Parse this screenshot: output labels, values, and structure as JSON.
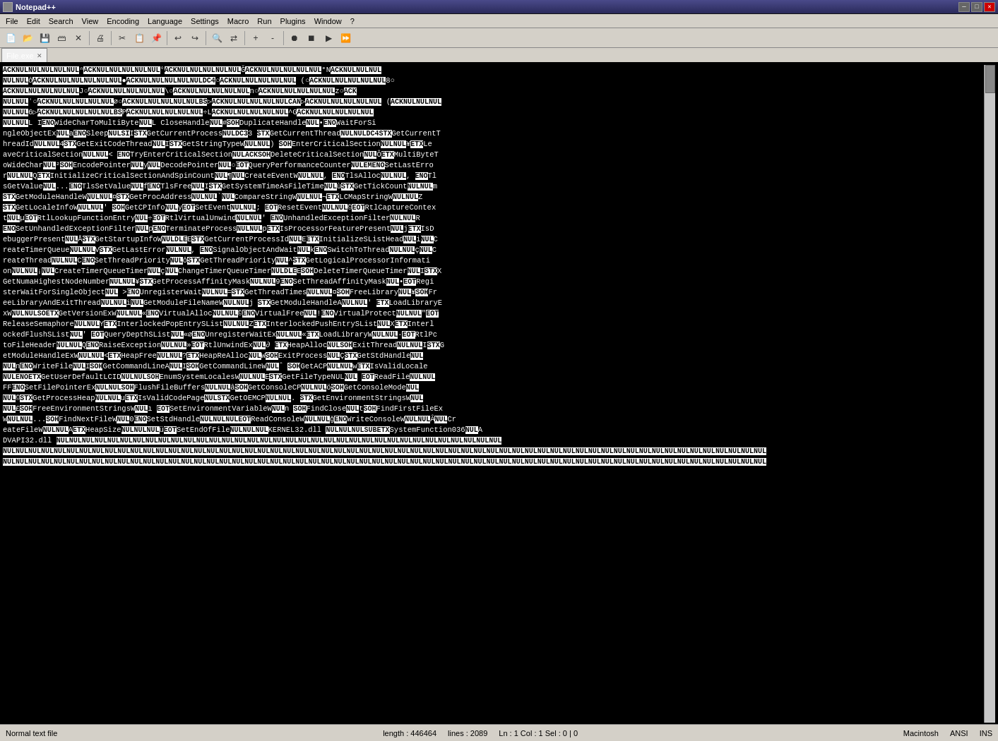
{
  "titleBar": {
    "title": "Notepad++",
    "minimize": "─",
    "maximize": "□",
    "close": "✕"
  },
  "menuBar": {
    "items": [
      "File",
      "Edit",
      "Search",
      "View",
      "Encoding",
      "Language",
      "Settings",
      "Macro",
      "Run",
      "Plugins",
      "Window",
      "?"
    ]
  },
  "tabs": [
    {
      "label": "File.exe",
      "active": true
    }
  ],
  "statusBar": {
    "mode": "Normal text file",
    "length": "length : 446464",
    "lines": "lines : 2089",
    "position": "Ln : 1   Col : 1   Sel : 0 | 0",
    "lineEnding": "Macintosh",
    "encoding": "ANSI",
    "ins": "INS"
  }
}
